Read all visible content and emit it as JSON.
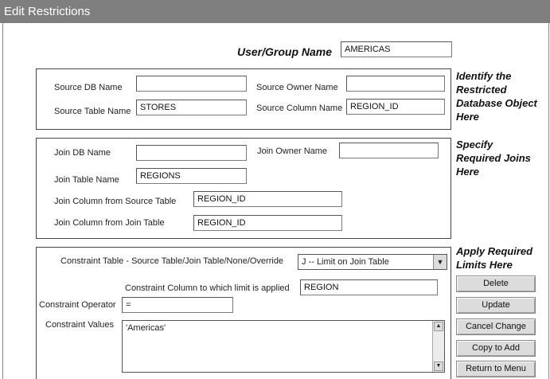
{
  "window": {
    "title": "Edit Restrictions"
  },
  "user": {
    "label": "User/Group Name",
    "value": "AMERICAS"
  },
  "source": {
    "db_name_label": "Source DB Name",
    "db_name_value": "",
    "owner_name_label": "Source Owner Name",
    "owner_name_value": "",
    "table_name_label": "Source Table Name",
    "table_name_value": "STORES",
    "column_name_label": "Source Column Name",
    "column_name_value": "REGION_ID",
    "side_text": [
      "Identify the",
      "Restricted",
      "Database Object",
      "Here"
    ]
  },
  "join": {
    "db_name_label": "Join DB Name",
    "db_name_value": "",
    "owner_name_label": "Join Owner Name",
    "owner_name_value": "",
    "table_name_label": "Join Table Name",
    "table_name_value": "REGIONS",
    "col_source_label": "Join Column from Source Table",
    "col_source_value": "REGION_ID",
    "col_join_label": "Join Column from Join Table",
    "col_join_value": "REGION_ID",
    "side_text": [
      "Specify",
      "Required Joins",
      "Here"
    ]
  },
  "constraint": {
    "table_label": "Constraint Table - Source Table/Join Table/None/Override",
    "table_value": "J --  Limit on Join Table",
    "column_label": "Constraint Column to which limit is applied",
    "column_value": "REGION",
    "operator_label": "Constraint Operator",
    "operator_value": "=",
    "values_label": "Constraint Values",
    "values_value": "'Americas'",
    "side_text": [
      "Apply Required",
      "Limits Here"
    ]
  },
  "buttons": {
    "delete": "Delete",
    "update": "Update",
    "cancel": "Cancel Change",
    "copy": "Copy to Add",
    "return": "Return to Menu"
  },
  "icons": {
    "dropdown": "chevron-down-icon",
    "scroll_up": "arrow-up-icon",
    "scroll_down": "arrow-down-icon"
  }
}
